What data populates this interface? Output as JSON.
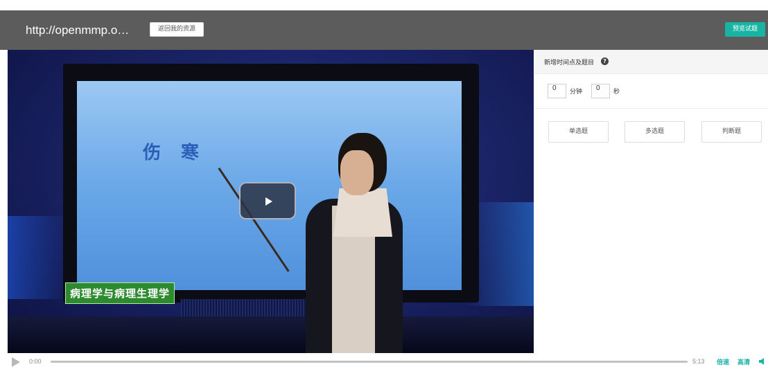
{
  "header": {
    "url_title": "http://openmmp.o…",
    "back_button_label": "返回我的资源",
    "preview_button_label": "预览试题"
  },
  "video": {
    "screen_text": "伤 寒",
    "subject_caption": "病理学与病理生理学",
    "play_icon": "play-icon"
  },
  "panel": {
    "title": "新增时间点及题目",
    "help_icon": "?",
    "minutes_value": "0",
    "minutes_unit": "分钟",
    "seconds_value": "0",
    "seconds_unit": "秒",
    "question_types": [
      "单选题",
      "多选题",
      "判断题"
    ]
  },
  "controls": {
    "current_time": "0:00",
    "duration": "5:13",
    "speed_label": "倍速",
    "quality_label": "高清",
    "progress_fraction": 0,
    "accent_color": "#17b3a3"
  }
}
